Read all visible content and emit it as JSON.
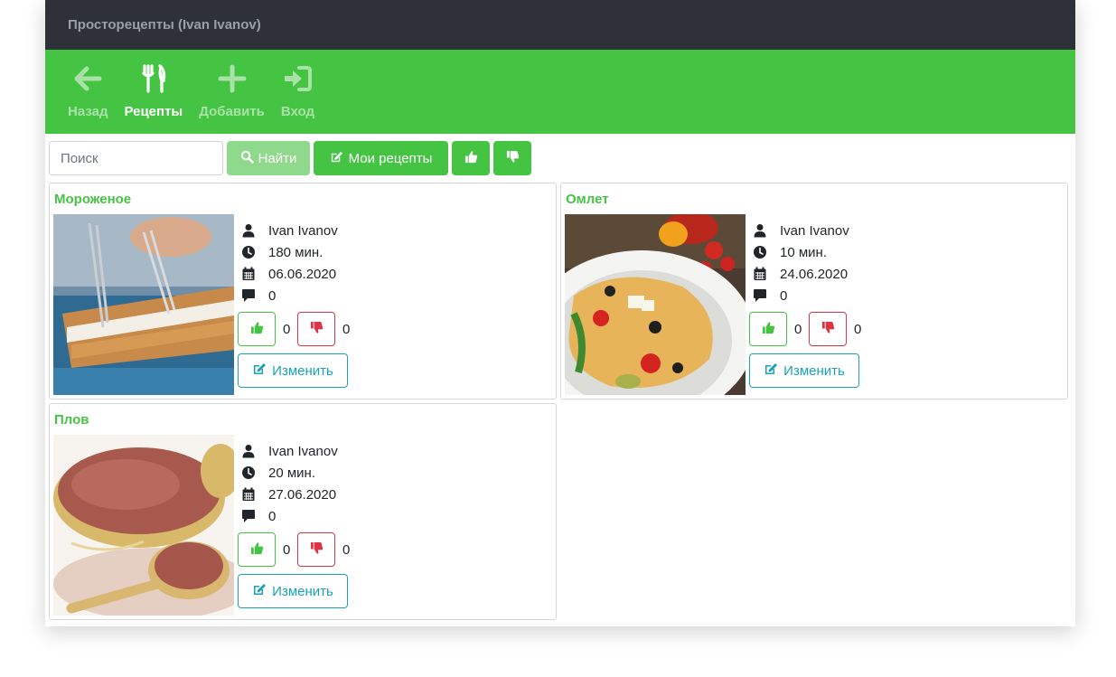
{
  "header": {
    "title": "Просторецепты (Ivan Ivanov)"
  },
  "nav": {
    "back": "Назад",
    "recipes": "Рецепты",
    "add": "Добавить",
    "login": "Вход"
  },
  "toolbar": {
    "search_placeholder": "Поиск",
    "find_label": "Найти",
    "my_recipes_label": "Мои рецепты"
  },
  "colors": {
    "accent": "#45c443",
    "topbar": "#2e3238",
    "edit": "#17a2b8",
    "danger": "#dc3545"
  },
  "recipes": [
    {
      "title": "Мороженое",
      "author": "Ivan Ivanov",
      "time": "180 мин.",
      "date": "06.06.2020",
      "comments": "0",
      "likes": "0",
      "dislikes": "0",
      "edit_label": "Изменить"
    },
    {
      "title": "Омлет",
      "author": "Ivan Ivanov",
      "time": "10 мин.",
      "date": "24.06.2020",
      "comments": "0",
      "likes": "0",
      "dislikes": "0",
      "edit_label": "Изменить"
    },
    {
      "title": "Плов",
      "author": "Ivan Ivanov",
      "time": "20 мин.",
      "date": "27.06.2020",
      "comments": "0",
      "likes": "0",
      "dislikes": "0",
      "edit_label": "Изменить"
    }
  ]
}
